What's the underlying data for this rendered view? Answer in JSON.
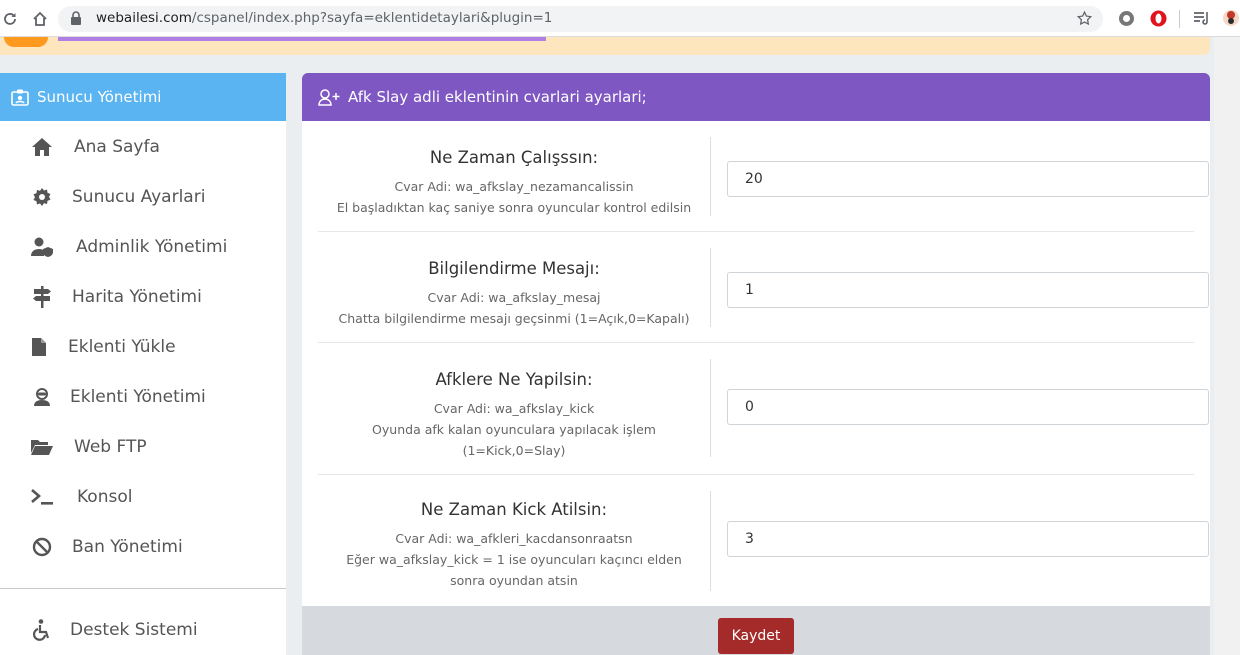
{
  "browser": {
    "url_domain": "webailesi.com",
    "url_path": "/cspanel/index.php?sayfa=eklentidetaylari&plugin=1",
    "icons": [
      "reload-icon",
      "home-icon",
      "lock-icon",
      "bookmark-star-icon",
      "extension-icon",
      "opera-icon",
      "reading-list-icon",
      "profile-icon"
    ]
  },
  "sidebar": {
    "header": "Sunucu Yönetimi",
    "items": [
      {
        "label": "Ana Sayfa",
        "icon": "home-icon"
      },
      {
        "label": "Sunucu Ayarlari",
        "icon": "gear-icon"
      },
      {
        "label": "Adminlik Yönetimi",
        "icon": "user-shield-icon"
      },
      {
        "label": "Harita Yönetimi",
        "icon": "signpost-icon"
      },
      {
        "label": "Eklenti Yükle",
        "icon": "file-icon"
      },
      {
        "label": "Eklenti Yönetimi",
        "icon": "user-secret-icon"
      },
      {
        "label": "Web FTP",
        "icon": "folder-open-icon"
      },
      {
        "label": "Konsol",
        "icon": "terminal-icon"
      },
      {
        "label": "Ban Yönetimi",
        "icon": "ban-icon"
      },
      {
        "label": "Destek Sistemi",
        "icon": "wheelchair-icon"
      }
    ]
  },
  "panel": {
    "title": "Afk Slay adli eklentinin cvarlari ayarlari;",
    "settings": [
      {
        "title": "Ne Zaman Çalışssın:",
        "cvar": "Cvar Adi: wa_afkslay_nezamancalissin",
        "help": [
          "El başladıktan kaç saniye sonra oyuncular kontrol edilsin"
        ],
        "value": "20"
      },
      {
        "title": "Bilgilendirme Mesajı:",
        "cvar": "Cvar Adi: wa_afkslay_mesaj",
        "help": [
          "Chatta bilgilendirme mesajı geçsinmi (1=Açık,0=Kapalı)"
        ],
        "value": "1"
      },
      {
        "title": "Afklere Ne Yapilsin:",
        "cvar": "Cvar Adi: wa_afkslay_kick",
        "help": [
          "Oyunda afk kalan oyunculara yapılacak işlem",
          "(1=Kick,0=Slay)"
        ],
        "value": "0"
      },
      {
        "title": "Ne Zaman Kick Atilsin:",
        "cvar": "Cvar Adi: wa_afkleri_kacdansonraatsn",
        "help": [
          "Eğer wa_afkslay_kick = 1 ise oyuncuları kaçıncı elden",
          "sonra oyundan atsin"
        ],
        "value": "3"
      }
    ],
    "save_label": "Kaydet"
  },
  "colors": {
    "sidebar_header": "#5ab4f2",
    "panel_header": "#7e57c2",
    "save_button": "#a52a2a",
    "notice_bar": "#fde5bd",
    "notice_accent": "#ff9a1f"
  }
}
